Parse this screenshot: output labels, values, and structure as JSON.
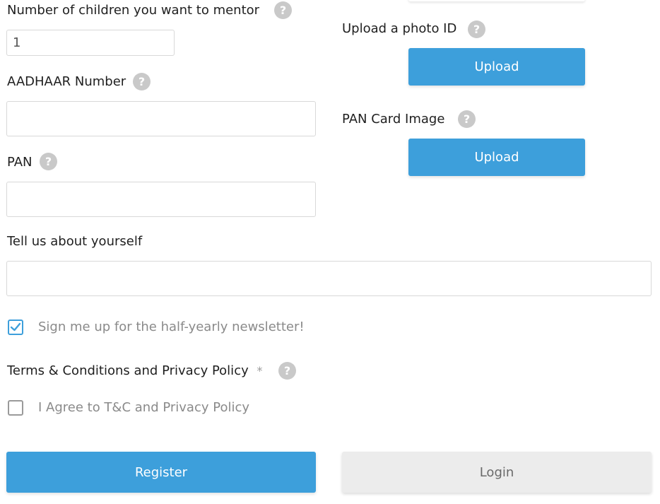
{
  "fields": {
    "children": {
      "label": "Number of children you want to mentor",
      "value": "1"
    },
    "aadhaar": {
      "label": "AADHAAR Number",
      "value": ""
    },
    "pan": {
      "label": "PAN",
      "value": ""
    },
    "about": {
      "label": "Tell us about yourself",
      "value": ""
    }
  },
  "uploads": {
    "photo_id": {
      "label": "Upload a photo ID",
      "button": "Upload"
    },
    "pan_card": {
      "label": "PAN Card Image",
      "button": "Upload"
    }
  },
  "newsletter": {
    "label": "Sign me up for the half-yearly newsletter!",
    "checked": true
  },
  "terms": {
    "heading": "Terms & Conditions and Privacy Policy",
    "required_mark": "*",
    "checkbox_label": "I Agree to T&C and Privacy Policy",
    "checked": false
  },
  "help_glyph": "?",
  "actions": {
    "register": "Register",
    "login": "Login"
  },
  "colors": {
    "accent": "#3d9fdb",
    "secondary_button": "#ececec",
    "help_icon": "#c9c9c9"
  }
}
